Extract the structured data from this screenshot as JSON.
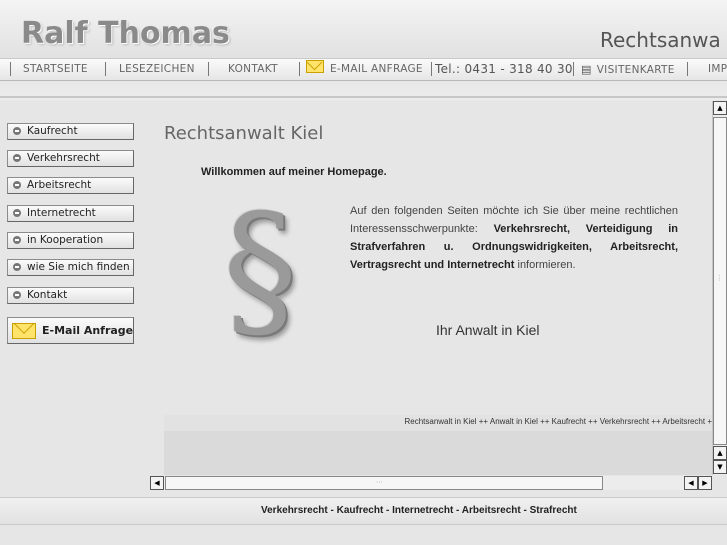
{
  "header": {
    "brand": "Ralf Thomas",
    "tagline": "Rechtsanwa"
  },
  "nav": {
    "startseite": "STARTSEITE",
    "lesezeichen": "LESEZEICHEN",
    "kontakt": "KONTAKT",
    "email_anfrage": "E-MAIL ANFRAGE",
    "phone": "Tel.: 0431 - 318 40 30",
    "visitenkarte": "VISITENKARTE",
    "impressum_partial": "IMP"
  },
  "sidebar": {
    "items": [
      {
        "label": "Kaufrecht"
      },
      {
        "label": "Verkehrsrecht"
      },
      {
        "label": "Arbeitsrecht"
      },
      {
        "label": "Internetrecht"
      },
      {
        "label": "in Kooperation"
      },
      {
        "label": "wie Sie mich finden"
      },
      {
        "label": "Kontakt"
      }
    ],
    "email_button": "E-Mail Anfrage"
  },
  "content": {
    "title": "Rechtsanwalt Kiel",
    "welcome": "Willkommen auf meiner Homepage.",
    "paragraph": {
      "intro": "Auf den folgenden Seiten möchte ich Sie über meine rechtlichen Interessensschwerpunkte: ",
      "bold_topics": "Verkehrsrecht, Verteidigung in Strafverfahren u. Ordnungswidrigkeiten, Arbeitsrecht, Vertragsrecht und Internetrecht",
      "outro": " informieren."
    },
    "section_symbol": "§",
    "tagline": "Ihr Anwalt in Kiel",
    "ticker": "Rechtsanwalt in Kiel ++ Anwalt in Kiel ++ Kaufrecht ++ Verkehrsrecht ++ Arbeitsrecht +"
  },
  "footer": {
    "links": "Verkehrsrecht - Kaufrecht - Internetrecht - Arbeitsrecht - Strafrecht"
  },
  "icons": {
    "mail": "envelope-icon",
    "card": "business-card-icon",
    "bullet": "arrow-bullet-icon"
  },
  "colors": {
    "background": "#e6e6e6",
    "brand_text": "#8a8a8a",
    "email_accent": "#ffe36b"
  }
}
